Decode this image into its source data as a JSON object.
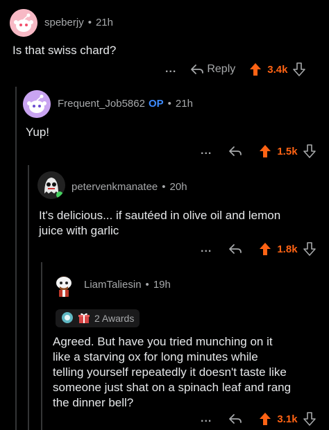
{
  "comments": [
    {
      "username": "speberjy",
      "time": "21h",
      "body": "Is that swiss chard?",
      "reply_label": "Reply",
      "score": "3.4k",
      "more": "..."
    },
    {
      "username": "Frequent_Job5862",
      "op_badge": "OP",
      "time": "21h",
      "body": "Yup!",
      "score": "1.5k",
      "more": "..."
    },
    {
      "username": "petervenkmanatee",
      "time": "20h",
      "body_line1": "It's delicious... if sautéed in olive oil and lemon",
      "body_line2": "juice with garlic",
      "score": "1.8k",
      "more": "..."
    },
    {
      "username": "LiamTaliesin",
      "time": "19h",
      "awards_label": "2 Awards",
      "body_lines": [
        "Agreed. But have you tried munching on it",
        "like a starving ox for long minutes while",
        "telling yourself repeatedly it doesn't taste like",
        "someone just shat on a spinach leaf and rang",
        "the dinner bell?"
      ],
      "score": "3.1k",
      "more": "..."
    }
  ],
  "colors": {
    "upvote": "#ff6314",
    "op": "#3d8bff",
    "thread_line": "#343536"
  }
}
